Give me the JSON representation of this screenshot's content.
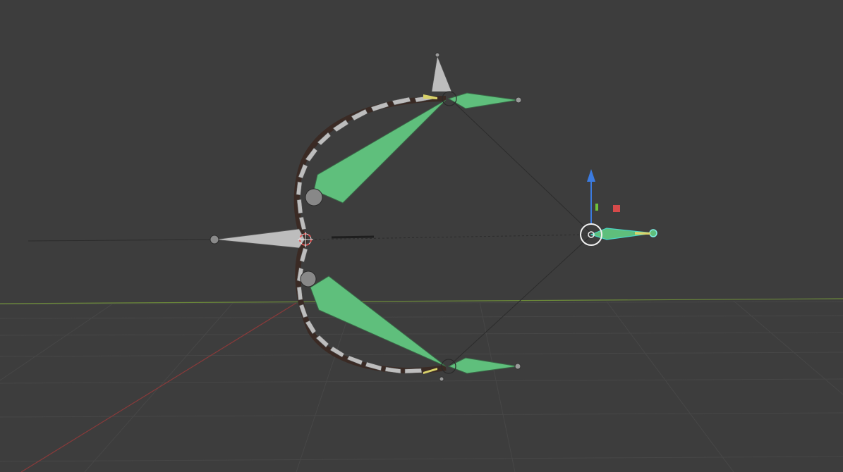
{
  "viewport": {
    "background": "#3d3d3d",
    "grid_color": "#474747",
    "x_axis_color": "#8a3a3a",
    "y_axis_color": "#6c8a3a"
  },
  "armature": {
    "selected_bone_color": "#5fbf7c",
    "unselected_bone_color": "#bdbdbd",
    "chain_outline_color": "#3a2a24"
  },
  "gizmo": {
    "z_arrow_color": "#3b7be0",
    "x_handle_color": "#d64a4a",
    "y_handle_color": "#6fc23a",
    "icons": [
      "move-gizmo-icon",
      "z-axis-arrow-icon",
      "x-axis-handle-icon",
      "y-axis-handle-icon"
    ]
  },
  "cursor": {
    "icon": "3d-cursor-icon",
    "color": "#e05050"
  }
}
